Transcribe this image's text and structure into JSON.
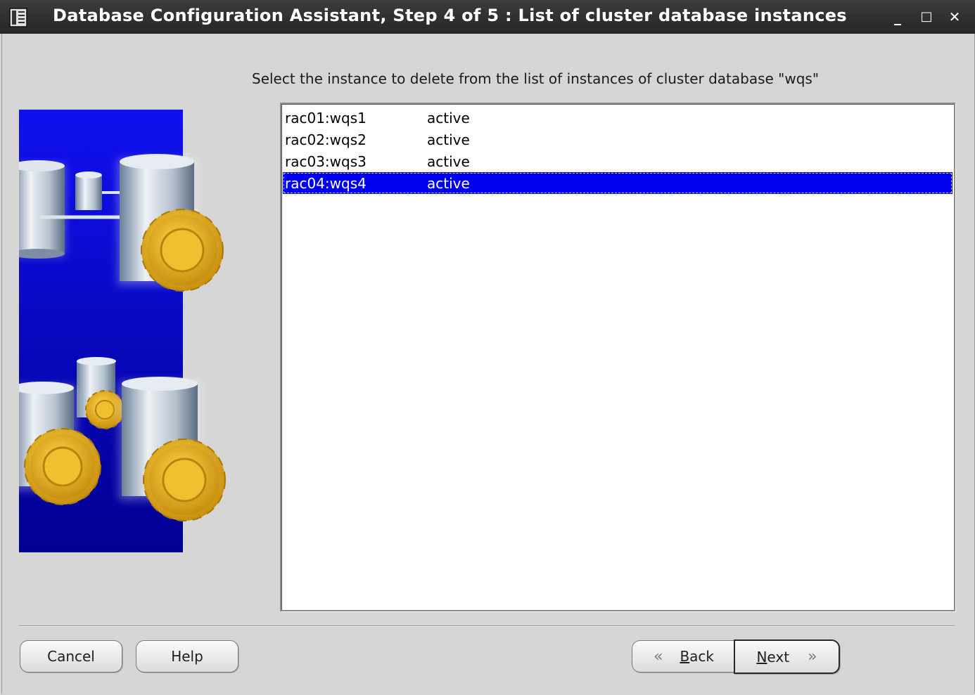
{
  "window": {
    "title": "Database Configuration Assistant, Step 4 of 5 : List of cluster database instances",
    "controls": {
      "minimize": "_",
      "maximize": "□",
      "close": "✕"
    }
  },
  "main": {
    "instruction": "Select the instance to delete from the list of instances of cluster database \"wqs\"",
    "instances": [
      {
        "name": "rac01:wqs1",
        "status": "active",
        "selected": false
      },
      {
        "name": "rac02:wqs2",
        "status": "active",
        "selected": false
      },
      {
        "name": "rac03:wqs3",
        "status": "active",
        "selected": false
      },
      {
        "name": "rac04:wqs4",
        "status": "active",
        "selected": true
      }
    ]
  },
  "footer": {
    "cancel_label": "Cancel",
    "help_label": "Help",
    "back": {
      "mnemonic": "B",
      "rest": "ack",
      "icon": "double-chevron-left-icon"
    },
    "next": {
      "mnemonic": "N",
      "rest": "ext",
      "icon": "double-chevron-right-icon"
    }
  },
  "colors": {
    "selection": "#0000ee",
    "side_panel_bg": "#0a0ad8",
    "gear": "#e8b020"
  }
}
